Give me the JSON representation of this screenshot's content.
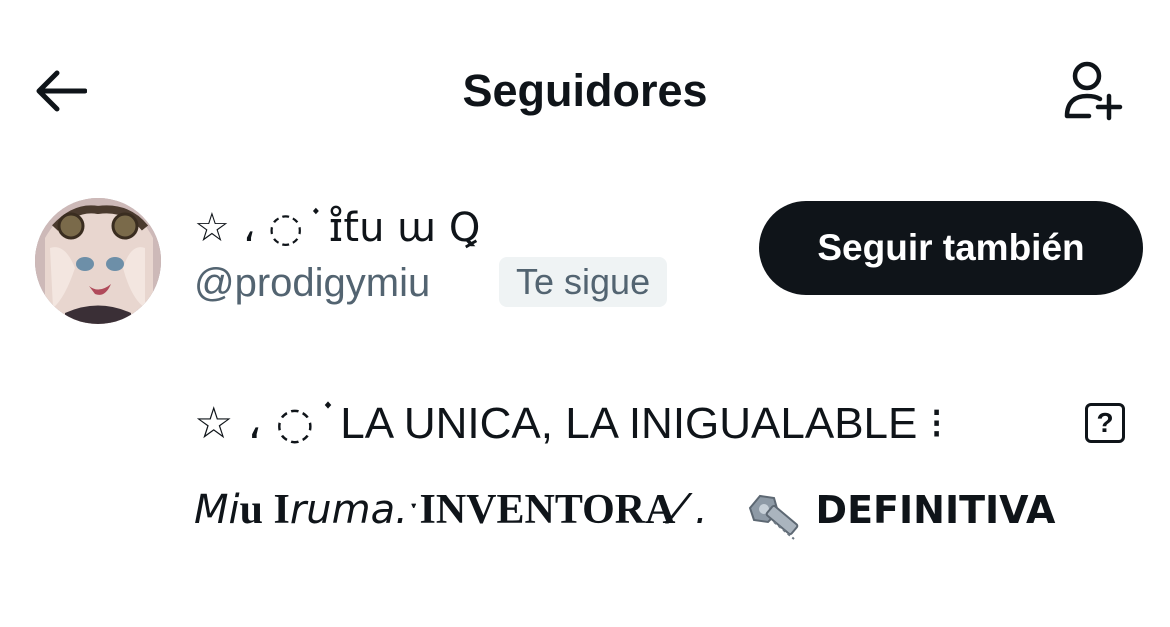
{
  "header": {
    "back_icon": "arrow-left-icon",
    "title": "Seguidores",
    "add_icon": "person-add-icon"
  },
  "follower": {
    "avatar_icon": "avatar",
    "display_name": "☆ ، ◌ ֗ ɪ̊ƭս ա Ꝗ",
    "handle": "@prodigymiu",
    "badge": "Te sigue",
    "follow_button": "Seguir también",
    "bio_line1_prefix": "☆ ،        ◌ ֗",
    "bio_line1_text": "LA UNICA, LA INIGUALABLE",
    "bio_line1_suffix": "⁝",
    "bio_line1_box": "?",
    "bio_line2_a": "Mi",
    "bio_line2_b": "u I",
    "bio_line2_c": "ruma.",
    "bio_line2_d": "ˑINVENTORA",
    "bio_line2_e": "⁄ .",
    "bio_line2_emoji": "nut-and-bolt-icon",
    "bio_line2_f": "DEFINITIVA"
  }
}
